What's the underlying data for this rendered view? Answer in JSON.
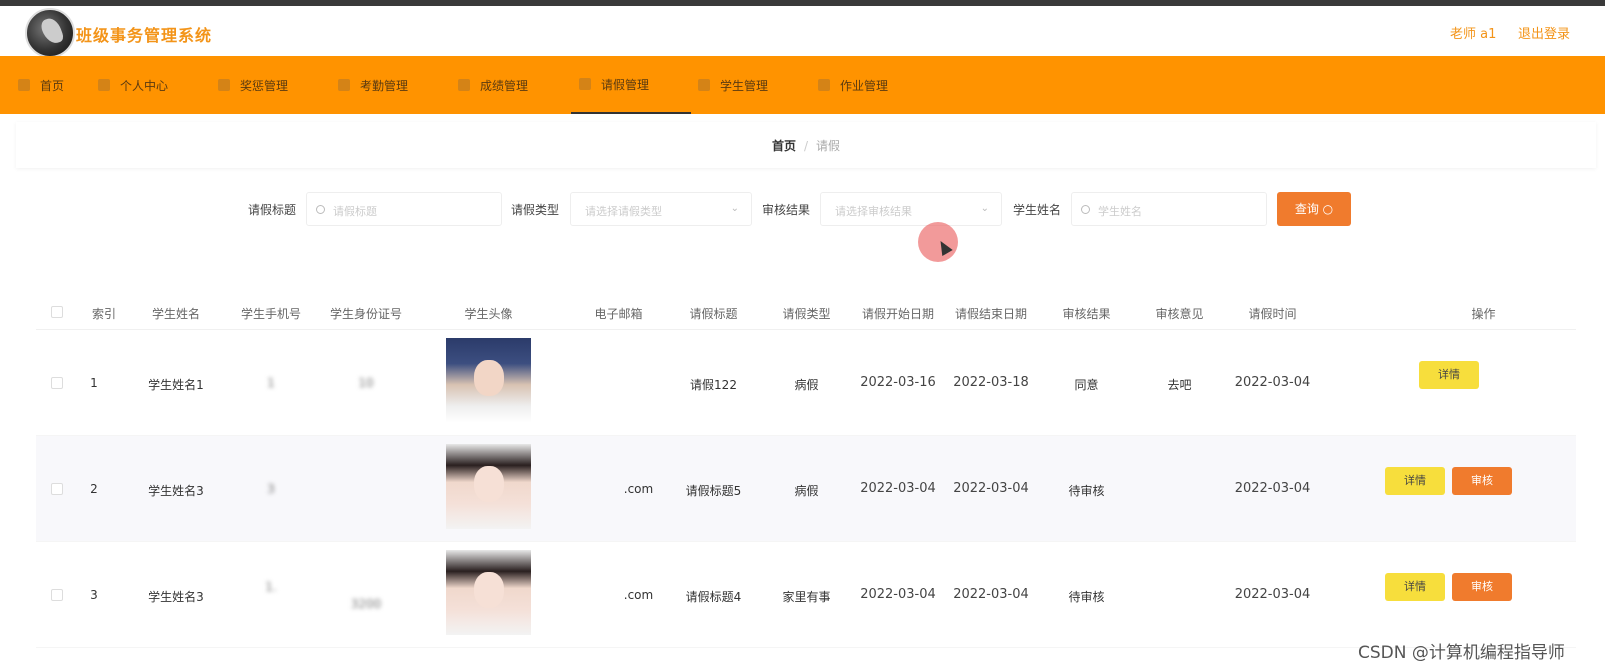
{
  "header": {
    "title": "班级事务管理系统",
    "user": "老师 a1",
    "logout": "退出登录"
  },
  "nav": [
    {
      "label": "首页",
      "icon": "home-icon"
    },
    {
      "label": "个人中心",
      "icon": "user-icon"
    },
    {
      "label": "奖惩管理",
      "icon": "award-icon"
    },
    {
      "label": "考勤管理",
      "icon": "attendance-icon"
    },
    {
      "label": "成绩管理",
      "icon": "grade-icon"
    },
    {
      "label": "请假管理",
      "icon": "leave-icon",
      "active": true
    },
    {
      "label": "学生管理",
      "icon": "student-icon"
    },
    {
      "label": "作业管理",
      "icon": "homework-icon"
    }
  ],
  "breadcrumb": {
    "home": "首页",
    "separator": "/",
    "current": "请假"
  },
  "search": {
    "title_label": "请假标题",
    "title_placeholder": "请假标题",
    "type_label": "请假类型",
    "type_placeholder": "请选择请假类型",
    "result_label": "审核结果",
    "result_placeholder": "请选择审核结果",
    "name_label": "学生姓名",
    "name_placeholder": "学生姓名",
    "query_button": "查询"
  },
  "table": {
    "columns": [
      "索引",
      "学生姓名",
      "学生手机号",
      "学生身份证号",
      "学生头像",
      "电子邮箱",
      "请假标题",
      "请假类型",
      "请假开始日期",
      "请假结束日期",
      "审核结果",
      "审核意见",
      "请假时间",
      "操作"
    ],
    "rows": [
      {
        "index": "1",
        "name": "学生姓名1",
        "phone": "1",
        "idcard": "10",
        "email": "",
        "title": "请假122",
        "type": "病假",
        "start": "2022-03-16",
        "end": "2022-03-18",
        "result": "同意",
        "opinion": "去吧",
        "time": "2022-03-04",
        "avatar": "male"
      },
      {
        "index": "2",
        "name": "学生姓名3",
        "phone": "3",
        "idcard": "",
        "email": ".com",
        "title": "请假标题5",
        "type": "病假",
        "start": "2022-03-04",
        "end": "2022-03-04",
        "result": "待审核",
        "opinion": "",
        "time": "2022-03-04",
        "avatar": "female"
      },
      {
        "index": "3",
        "name": "学生姓名3",
        "phone": "1.",
        "idcard": "3200",
        "email": ".com",
        "title": "请假标题4",
        "type": "家里有事",
        "start": "2022-03-04",
        "end": "2022-03-04",
        "result": "待审核",
        "opinion": "",
        "time": "2022-03-04",
        "avatar": "female"
      }
    ],
    "detail_button": "详情",
    "review_button": "审核"
  },
  "watermark": "CSDN @计算机编程指导师"
}
